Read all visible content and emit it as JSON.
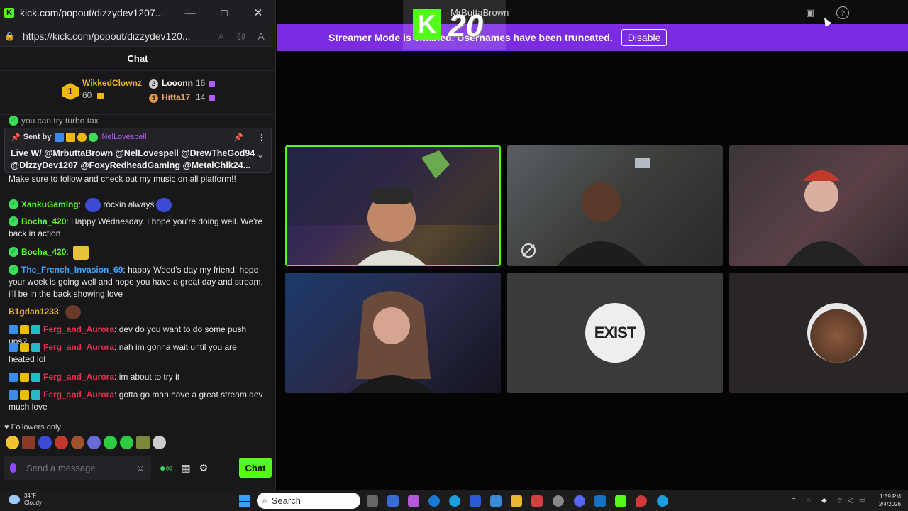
{
  "window": {
    "title": "kick.com/popout/dizzydev1207...",
    "url": "https://kick.com/popout/dizzydev120...",
    "minimize": "—",
    "maximize": "□",
    "close": "✕"
  },
  "chat": {
    "header": "Chat",
    "leaderboard": {
      "first": {
        "rank": "1",
        "name": "WikkedClownz",
        "count": "60"
      },
      "second": {
        "name": "Looonn",
        "count": "16"
      },
      "third": {
        "name": "Hitta17",
        "count": "14"
      }
    },
    "partial_top": "you can try turbo tax",
    "pinned": {
      "sent_by": "Sent by",
      "user": "NelLovespell",
      "text": "Live W/ @MrbuttaBrown @NelLovespell @DrewTheGod94\n@DizzyDev1207 @FoxyRedheadGaming @MetalChik24..."
    },
    "messages": [
      {
        "user": "",
        "text": "Make sure to follow and check out my music on all platform!!"
      },
      {
        "user": "XankuGaming",
        "text": "rockin always"
      },
      {
        "user": "Bocha_420",
        "text": "Happy Wednesday. I hope you're doing well. We're back in action"
      },
      {
        "user": "Bocha_420",
        "text": ""
      },
      {
        "user": "The_French_Invasion_69",
        "text": "happy Weed's day my friend! hope your week is going well and hope you have a great day and stream, i'll be in the back showing love"
      },
      {
        "user": "B1gdan1233",
        "text": ""
      },
      {
        "user": "Ferg_and_Aurora",
        "text": "dev do you want to do some push ups?"
      },
      {
        "user": "Ferg_and_Aurora",
        "text": "nah im gonna wait until you are heated lol"
      },
      {
        "user": "Ferg_and_Aurora",
        "text": "im about to try it"
      },
      {
        "user": "Ferg_and_Aurora",
        "text": "gotta go man have a great stream dev much love"
      }
    ],
    "followers_only": "Followers only",
    "input_placeholder": "Send a message",
    "send_label": "Chat"
  },
  "stream": {
    "top_title": "MrButtaBrown",
    "overlay_number": "20",
    "banner_text": "Streamer Mode is enabled. Usernames have been truncated.",
    "banner_visible": "Streamer Mode is ",
    "disable_label": "Disable",
    "tiles": [
      {
        "label": "participant-1",
        "active": true
      },
      {
        "label": "participant-2"
      },
      {
        "label": "participant-3"
      },
      {
        "label": "participant-4"
      },
      {
        "label": "participant-5",
        "avatar_text": "EXIST"
      },
      {
        "label": "participant-6"
      }
    ]
  },
  "taskbar": {
    "temperature": "34°F",
    "condition": "Cloudy",
    "search": "Search",
    "time": "1:59 PM",
    "date": "2/4/2026"
  },
  "colors": {
    "kick_green": "#53fc18",
    "banner_purple": "#7b2be2",
    "chat_bg": "#18181b",
    "username_red": "#e0334f",
    "username_green": "#53fc18",
    "username_purple": "#b15cff",
    "username_gold": "#f0b90b"
  }
}
